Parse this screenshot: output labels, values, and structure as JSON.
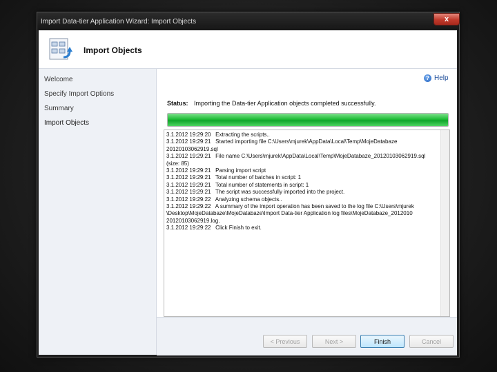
{
  "window": {
    "title": "Import Data-tier Application Wizard: Import Objects",
    "close_glyph": "x"
  },
  "header": {
    "title": "Import Objects",
    "icon": "wizard-objects-icon"
  },
  "nav": {
    "items": [
      {
        "label": "Welcome"
      },
      {
        "label": "Specify Import Options"
      },
      {
        "label": "Summary"
      },
      {
        "label": "Import Objects"
      }
    ]
  },
  "help": {
    "label": "Help",
    "icon": "help-icon"
  },
  "status": {
    "label": "Status:",
    "text": "Importing the Data-tier Application objects completed successfully.",
    "progress": 1.0,
    "progress_color": "#1fbd37"
  },
  "log": [
    "3.1.2012 19:29:20   Extracting the scripts..",
    "3.1.2012 19:29:21   Started importing file C:\\Users\\mjurek\\AppData\\Local\\Temp\\MojeDatabaze",
    "20120103062919.sql",
    "3.1.2012 19:29:21   File name C:\\Users\\mjurek\\AppData\\Local\\Temp\\MojeDatabaze_20120103062919.sql",
    "(size: 85)",
    "3.1.2012 19:29:21   Parsing import script",
    "3.1.2012 19:29:21   Total number of batches in script: 1",
    "3.1.2012 19:29:21   Total number of statements in script: 1",
    "3.1.2012 19:29:21   The script was successfully imported into the project.",
    "3.1.2012 19:29:22   Analyzing schema objects..",
    "3.1.2012 19:29:22   A summary of the import operation has been saved to the log file C:\\Users\\mjurek",
    "\\Desktop\\MojeDatabaze\\MojeDatabaze\\Import Data-tier Application log files\\MojeDatabaze_2012010",
    "20120103062919.log.",
    "3.1.2012 19:29:22   Click Finish to exit."
  ],
  "buttons": {
    "previous": "< Previous",
    "next": "Next >",
    "finish": "Finish",
    "cancel": "Cancel"
  }
}
